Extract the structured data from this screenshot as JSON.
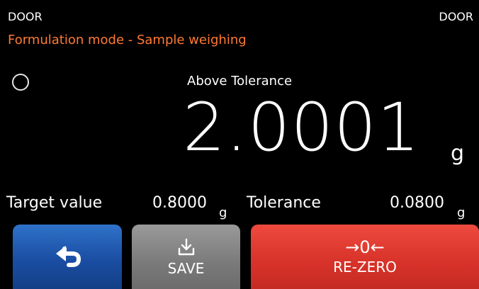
{
  "header": {
    "door_left": "DOOR",
    "door_right": "DOOR",
    "mode_title": "Formulation mode - Sample weighing"
  },
  "display": {
    "status": "Above Tolerance",
    "weight": "2.0001",
    "unit": "g"
  },
  "info": {
    "target_label": "Target value",
    "target_value": "0.8000",
    "target_unit": "g",
    "tolerance_label": "Tolerance",
    "tolerance_value": "0.0800",
    "tolerance_unit": "g"
  },
  "buttons": {
    "save_label": "SAVE",
    "rezero_icon": "→0←",
    "rezero_label": "RE-ZERO"
  },
  "icons": {
    "back": "return-arrow-icon",
    "save": "download-tray-icon",
    "stability": "stability-circle-icon"
  },
  "colors": {
    "mode_title": "#ff7a33",
    "back_button": "#1a4ea3",
    "save_button": "#7a7a7a",
    "rezero_button": "#d73229"
  }
}
